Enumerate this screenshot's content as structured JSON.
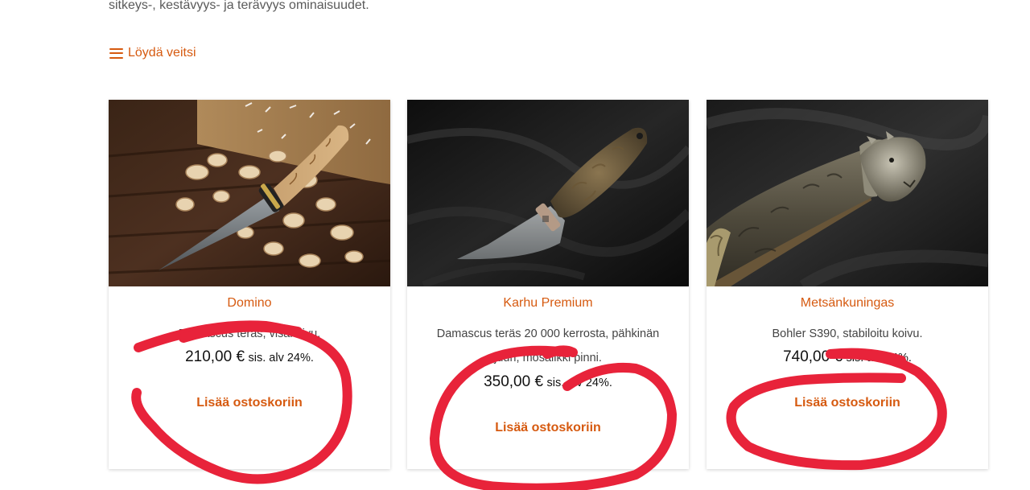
{
  "intro": {
    "text": "sitkeys-, kestävyys- ja terävyys ominaisuudet."
  },
  "filter": {
    "label": "Löydä veitsi",
    "icon": "menu-icon"
  },
  "products": [
    {
      "name": "Domino",
      "description": "Damascus teräs, visakoivu.",
      "price": "210,00 €",
      "tax": "sis. alv 24%.",
      "cart_label": "Lisää ostoskoriin"
    },
    {
      "name": "Karhu Premium",
      "description": "Damascus teräs 20 000 kerrosta, pähkinän juuri, mosaiikki pinni.",
      "price": "350,00 €",
      "tax": "sis. alv 24%.",
      "cart_label": "Lisää ostoskoriin"
    },
    {
      "name": "Metsänkuningas",
      "description": "Bohler S390, stabiloitu koivu.",
      "price": "740,00 €",
      "tax": "sis. alv 24%.",
      "cart_label": "Lisää ostoskoriin"
    }
  ],
  "colors": {
    "accent": "#d65a10",
    "annotation": "#e8233a"
  }
}
